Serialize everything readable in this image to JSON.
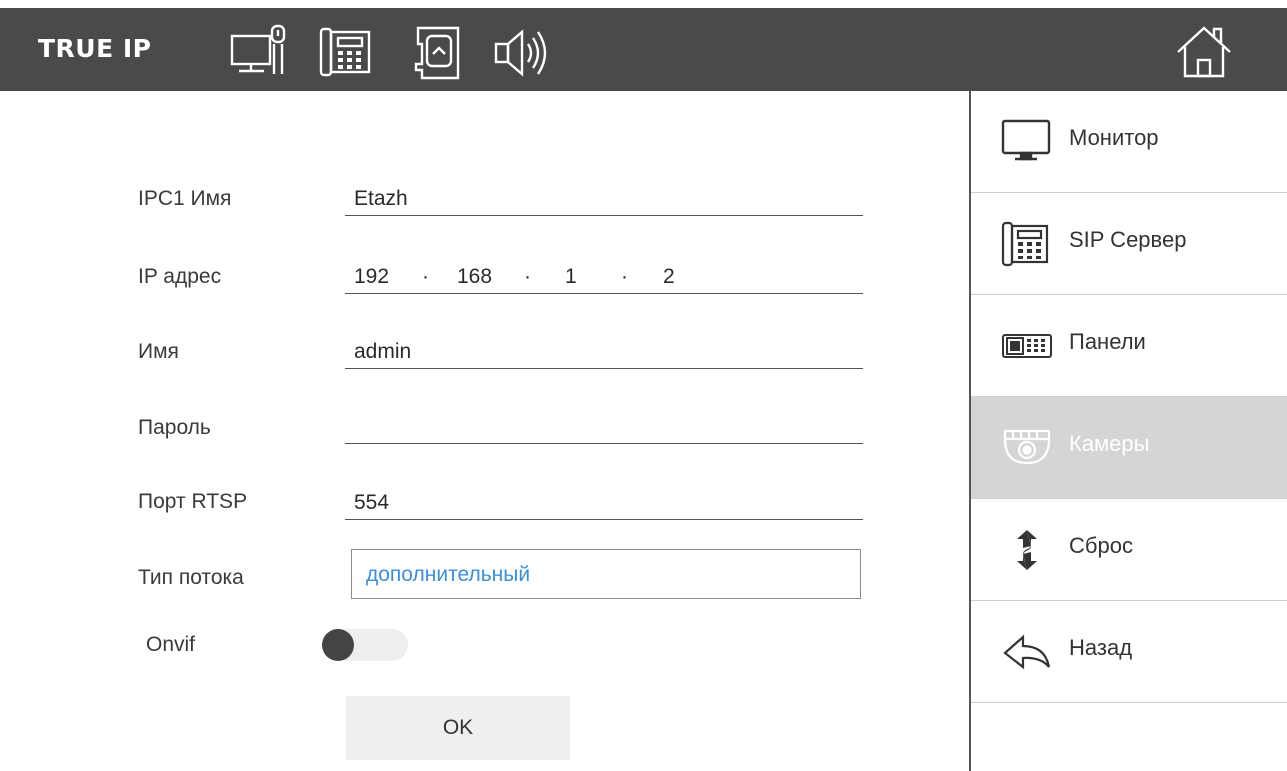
{
  "header": {
    "brand": "TRUE IP",
    "icons": [
      "monitor-settings-icon",
      "intercom-phone-icon",
      "sd-card-icon",
      "speaker-icon",
      "home-icon"
    ]
  },
  "form": {
    "name_label": "IPC1 Имя",
    "name_value": "Etazh",
    "ip_label": "IP адрес",
    "ip": [
      "192",
      "168",
      "1",
      "2"
    ],
    "ip_sep": "·",
    "user_label": "Имя",
    "user_value": "admin",
    "password_label": "Пароль",
    "password_value": "",
    "rtsp_label": "Порт RTSP",
    "rtsp_value": "554",
    "stream_label": "Тип потока",
    "stream_value": "дополнительный",
    "onvif_label": "Onvif",
    "onvif_on": false,
    "ok_label": "OK"
  },
  "sidebar": {
    "items": [
      {
        "label": "Монитор",
        "icon": "monitor-icon",
        "active": false
      },
      {
        "label": "SIP Сервер",
        "icon": "phone-keypad-icon",
        "active": false
      },
      {
        "label": "Панели",
        "icon": "door-panel-icon",
        "active": false
      },
      {
        "label": "Камеры",
        "icon": "dome-camera-icon",
        "active": true
      },
      {
        "label": "Сброс",
        "icon": "reset-arrows-icon",
        "active": false
      },
      {
        "label": "Назад",
        "icon": "back-arrow-icon",
        "active": false
      }
    ]
  },
  "colors": {
    "topbar": "#4a4a4a",
    "accent_text": "#3b8fe0",
    "active_item": "#d5d5d5"
  }
}
